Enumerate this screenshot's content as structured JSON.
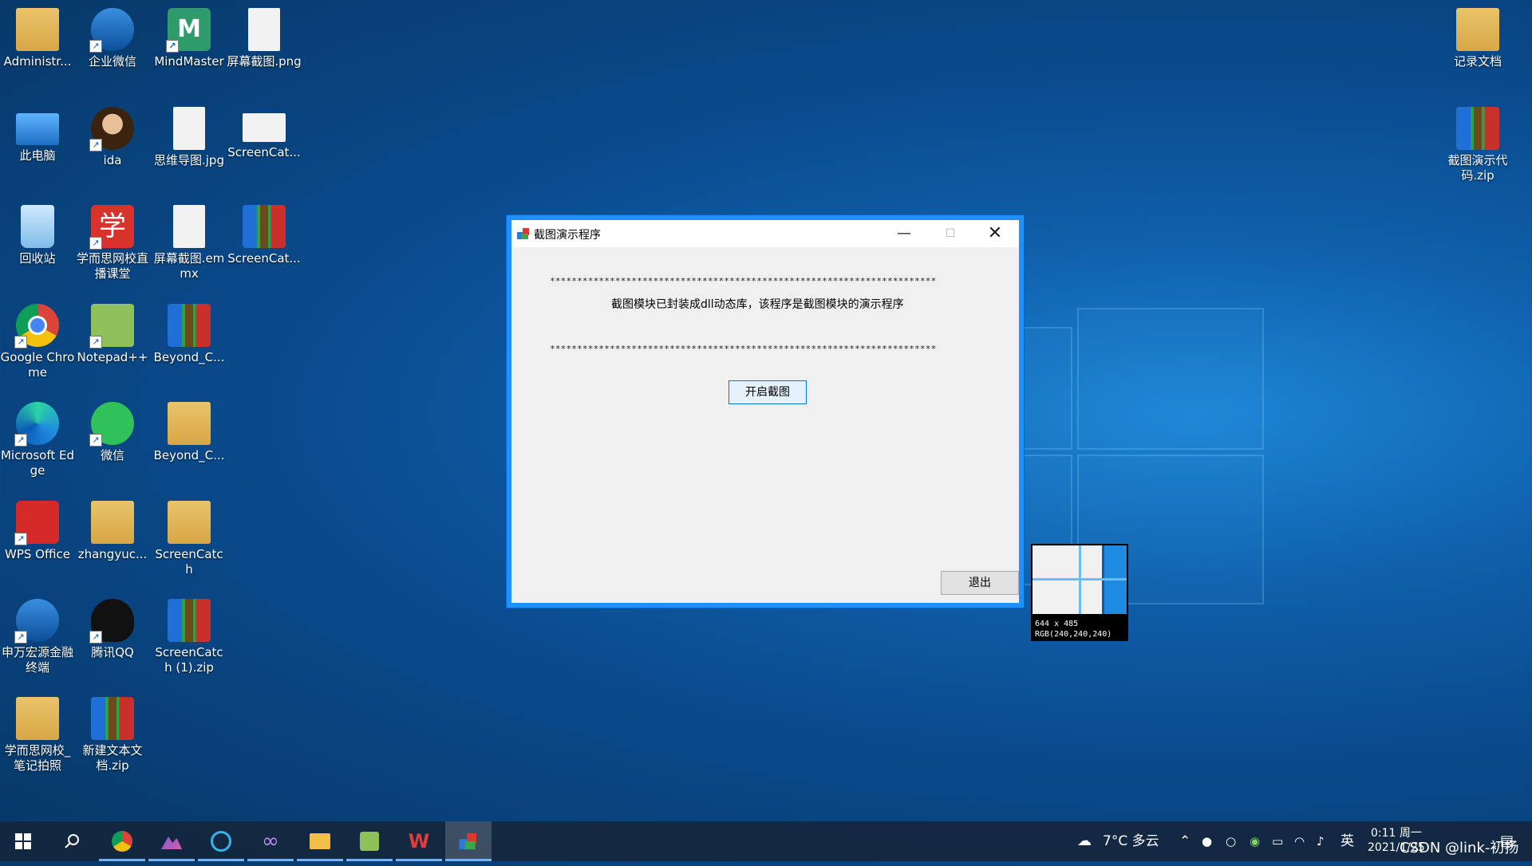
{
  "desktop": {
    "icons": [
      {
        "label": "Administr...",
        "icon": "user-folder"
      },
      {
        "label": "企业微信",
        "icon": "wecom"
      },
      {
        "label": "MindMaster",
        "icon": "mindmaster"
      },
      {
        "label": "屏幕截图.png",
        "icon": "image-file"
      },
      {
        "label": "此电脑",
        "icon": "computer"
      },
      {
        "label": "ida",
        "icon": "ida"
      },
      {
        "label": "思维导图.jpg",
        "icon": "image-file"
      },
      {
        "label": "ScreenCat...",
        "icon": "image-file"
      },
      {
        "label": "回收站",
        "icon": "recycle-bin"
      },
      {
        "label": "学而思网校直播课堂",
        "icon": "xueersi"
      },
      {
        "label": "屏幕截图.emmx",
        "icon": "file"
      },
      {
        "label": "ScreenCat...",
        "icon": "zip"
      },
      {
        "label": "Google Chrome",
        "icon": "chrome"
      },
      {
        "label": "Notepad++",
        "icon": "notepad"
      },
      {
        "label": "Beyond_C...",
        "icon": "zip"
      },
      {
        "label": "Microsoft Edge",
        "icon": "edge"
      },
      {
        "label": "微信",
        "icon": "wechat"
      },
      {
        "label": "Beyond_C...",
        "icon": "folder"
      },
      {
        "label": "WPS Office",
        "icon": "wps"
      },
      {
        "label": "zhangyuc...",
        "icon": "folder"
      },
      {
        "label": "ScreenCatch",
        "icon": "folder"
      },
      {
        "label": "申万宏源金融终端",
        "icon": "finance"
      },
      {
        "label": "腾讯QQ",
        "icon": "qq"
      },
      {
        "label": "ScreenCatch (1).zip",
        "icon": "zip"
      },
      {
        "label": "学而思网校_笔记拍照",
        "icon": "folder"
      },
      {
        "label": "新建文本文档.zip",
        "icon": "zip"
      },
      {
        "label": "记录文档",
        "icon": "folder"
      },
      {
        "label": "截图演示代码.zip",
        "icon": "zip"
      }
    ]
  },
  "dialog": {
    "title": "截图演示程序",
    "stars_line": "***********************************************************************",
    "description": "截图模块已封装成dll动态库，该程序是截图模块的演示程序",
    "start_button": "开启截图",
    "exit_button": "退出",
    "min_glyph": "—",
    "max_glyph": "☐",
    "close_glyph": "✕"
  },
  "magnifier": {
    "size_text": "644 x 485",
    "rgb_text": "RGB(240,240,240)"
  },
  "taskbar": {
    "weather": "7°C 多云",
    "ime": "英",
    "time": "0:11 周一",
    "date": "2021/1/25",
    "watermark": "CSDN @link-初扬"
  },
  "colors": {
    "accent": "#1e90ff",
    "dialog_bg": "#f0f0f0"
  }
}
